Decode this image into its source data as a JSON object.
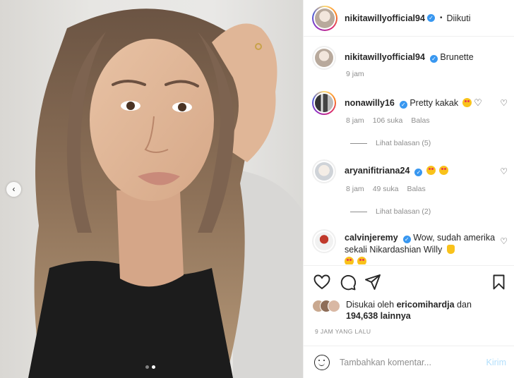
{
  "post": {
    "author": "nikitawillyofficial94",
    "follow_state": "Diikuti",
    "caption": "Brunette",
    "caption_time": "9 jam",
    "carousel": {
      "total": 2,
      "active": 2
    }
  },
  "comments": [
    {
      "user": "nonawilly16",
      "verified": true,
      "text": "Pretty kakak",
      "time": "8 jam",
      "likes": "106 suka",
      "reply_label": "Balas",
      "view_replies": "Lihat balasan (5)"
    },
    {
      "user": "aryanifitriana24",
      "verified": true,
      "text": "",
      "time": "8 jam",
      "likes": "49 suka",
      "reply_label": "Balas",
      "view_replies": "Lihat balasan (2)"
    },
    {
      "user": "calvinjeremy",
      "verified": true,
      "text": "Wow, sudah amerika sekali Nikardashian Willy"
    }
  ],
  "likes_summary": {
    "prefix": "Disukai oleh",
    "user": "ericomihardja",
    "conj": "dan",
    "count": "194,638 lainnya"
  },
  "timestamp": "9 JAM YANG LALU",
  "add_comment": {
    "placeholder": "Tambahkan komentar...",
    "post_label": "Kirim"
  },
  "icons": [
    "chevron-left-icon",
    "verified-icon",
    "heart-icon",
    "comment-icon",
    "share-icon",
    "bookmark-icon",
    "smiley-icon"
  ],
  "colors": {
    "verified": "#3897f0",
    "post_disabled": "#b2dffc",
    "meta_text": "#8e8e8e"
  }
}
